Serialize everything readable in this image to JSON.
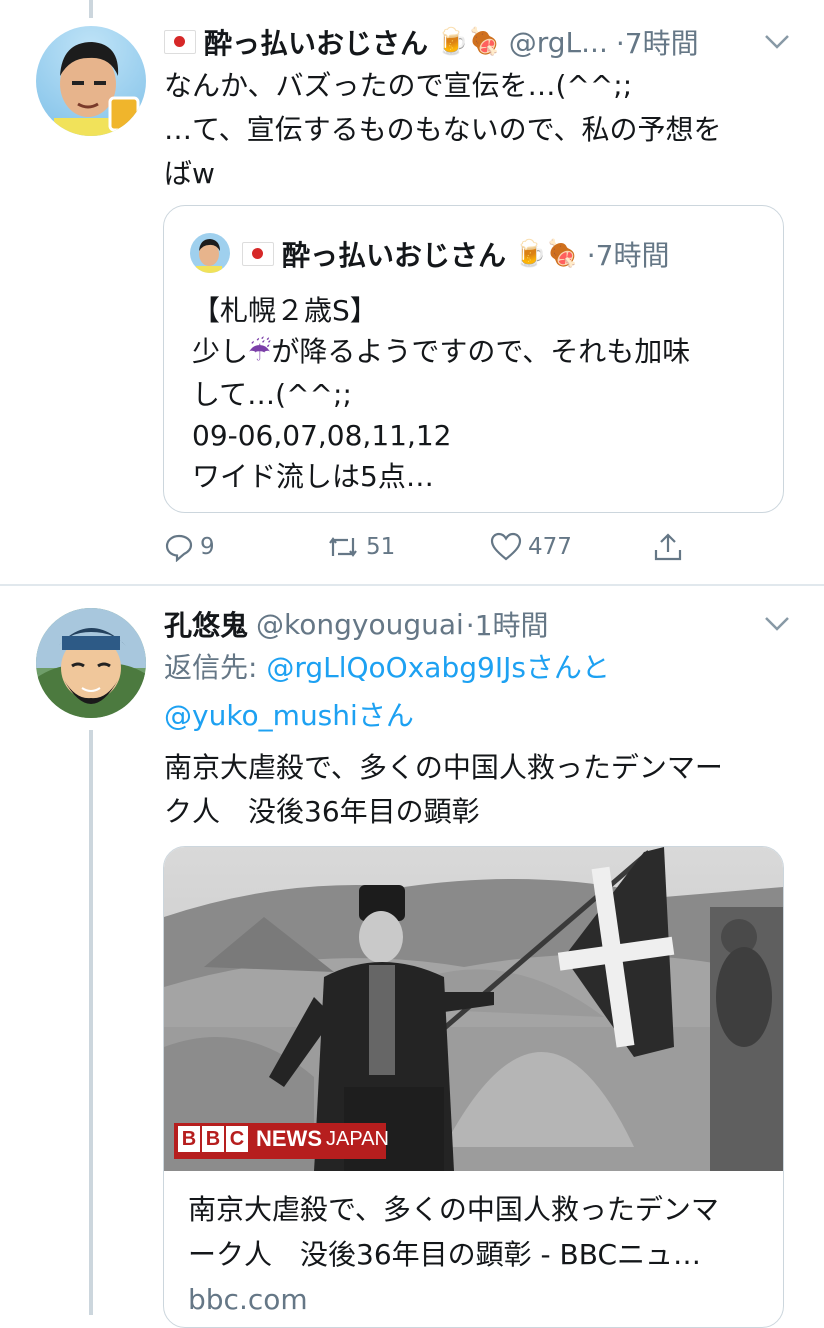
{
  "tweet1": {
    "display_name": "酔っ払いおじさん",
    "name_emojis": "🍺🍖",
    "handle": "@rgL...",
    "time": "·7時間",
    "text_line1": "なんか、バズったので宣伝を…(^^;;",
    "text_line2": "…て、宣伝するものもないので、私の予想を",
    "text_line3": "ばw",
    "quote": {
      "display_name": "酔っ払いおじさん",
      "name_emojis": "🍺🍖",
      "time": "·7時間",
      "line1": "【札幌２歳S】",
      "line2a": "少し",
      "line2_emoji": "☔",
      "line2b": "が降るようですので、それも加味",
      "line3": "して…(^^;;",
      "line4": "09-06,07,08,11,12",
      "line5": "ワイド流しは5点…"
    },
    "actions": {
      "replies": "9",
      "retweets": "51",
      "likes": "477"
    }
  },
  "tweet2": {
    "display_name": "孔悠鬼",
    "handle": "@kongyouguai",
    "time": "·1時間",
    "reply_prefix": "返信先: ",
    "reply_to1": "@rgLlQoOxabg9IJs",
    "reply_mid": "さんと",
    "reply_to2": "@yuko_mushi",
    "reply_suffix": "さん",
    "text_line1": "南京大虐殺で、多くの中国人救ったデンマー",
    "text_line2": "ク人　没後36年目の顕彰",
    "card": {
      "badge_bbc": "BBC",
      "badge_news": "NEWS",
      "badge_japan": "JAPAN",
      "title_line1": "南京大虐殺で、多くの中国人救ったデンマ",
      "title_line2": "ーク人　没後36年目の顕彰 - BBCニュ…",
      "domain": "bbc.com"
    }
  },
  "colors": {
    "accent": "#1da1f2",
    "muted": "#657786",
    "text": "#14171a",
    "border": "#ccd6dd"
  }
}
